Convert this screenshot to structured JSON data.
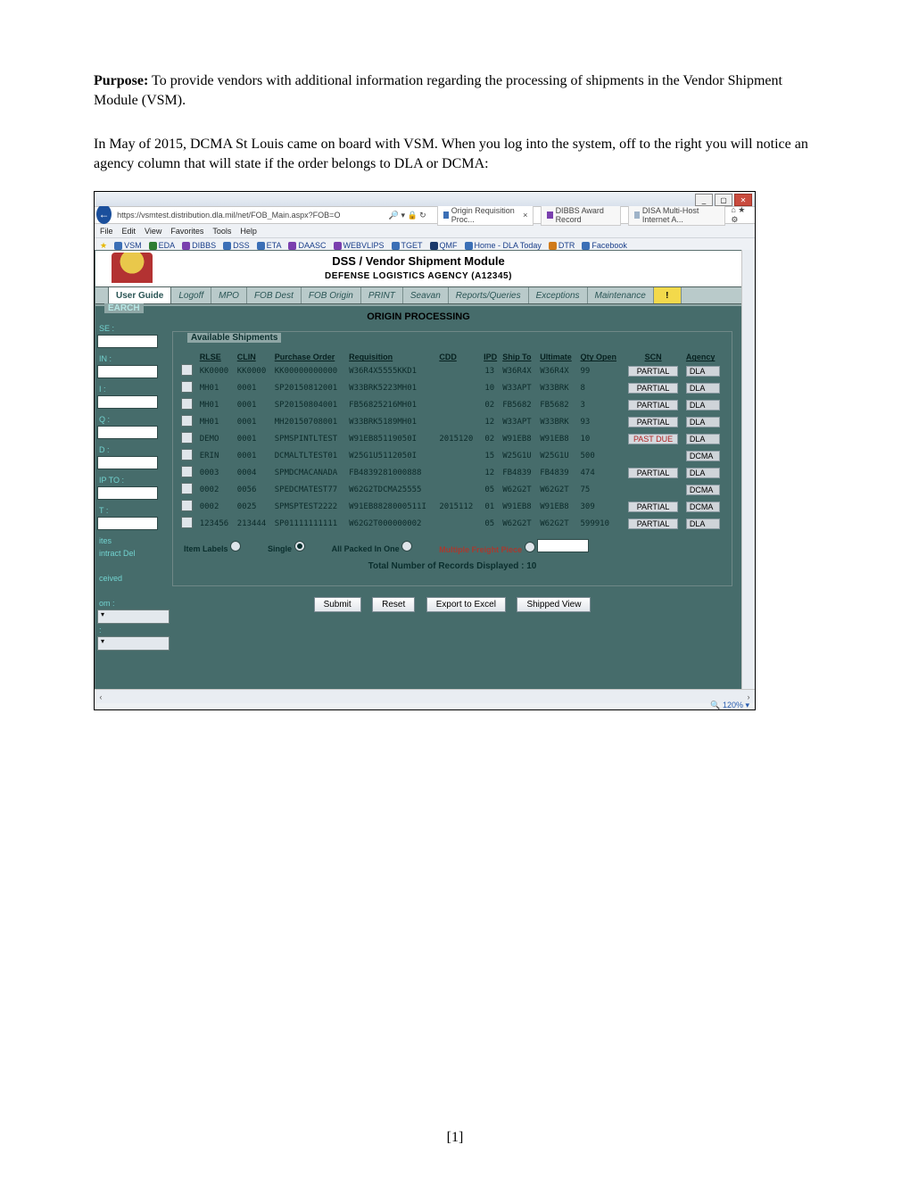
{
  "doc": {
    "purpose_label": "Purpose:",
    "purpose_text": "  To provide vendors with additional information regarding the processing of shipments in the Vendor Shipment Module (VSM).",
    "para2": "In May of 2015, DCMA St Louis came on board with VSM.  When you log into the system, off to the right you will notice an agency column that will state if the order belongs to DLA or DCMA:",
    "page_number": "[1]"
  },
  "browser": {
    "url": "https://vsmtest.distribution.dla.mil/net/FOB_Main.aspx?FOB=O",
    "search_hint": "🔎 ▾ 🔒 ↻",
    "tab1": "Origin Requisition Proc...",
    "tab2": "DIBBS Award Record",
    "tab3": "DISA Multi-Host Internet A...",
    "menu": [
      "File",
      "Edit",
      "View",
      "Favorites",
      "Tools",
      "Help"
    ],
    "favorites": [
      "VSM",
      "EDA",
      "DIBBS",
      "DSS",
      "ETA",
      "DAASC",
      "WEBVLIPS",
      "TGET",
      "QMF",
      "Home - DLA Today",
      "DTR",
      "Facebook"
    ],
    "zoom": "🔍 120%  ▾"
  },
  "app": {
    "banner_title": "DSS / Vendor Shipment Module",
    "banner_sub": "DEFENSE LOGISTICS AGENCY (A12345)",
    "tabs": [
      "User Guide",
      "Logoff",
      "MPO",
      "FOB Dest",
      "FOB Origin",
      "PRINT",
      "Seavan",
      "Reports/Queries",
      "Exceptions",
      "Maintenance"
    ],
    "section_title": "ORIGIN PROCESSING",
    "sidebar": {
      "legend": "EARCH",
      "lbls": [
        "SE :",
        "IN :",
        "I :",
        "Q :",
        "D :",
        "IP TO :",
        "T :",
        "ites",
        "intract Del",
        "ceived",
        "om :",
        ":"
      ]
    },
    "grid": {
      "legend": "Available Shipments",
      "headers": [
        "",
        "RLSE",
        "CLIN",
        "Purchase Order",
        "Requisition",
        "CDD",
        "IPD",
        "Ship To",
        "Ultimate",
        "Qty Open",
        "SCN",
        "Agency"
      ],
      "rows": [
        {
          "r": "KK0000",
          "c": "KK0000",
          "po": "KK00000000000",
          "rq": "W36R4X5555KKD1",
          "cdd": "",
          "ipd": "13",
          "st": "W36R4X",
          "ul": "W36R4X",
          "qo": "99",
          "scn": "PARTIAL",
          "ag": "DLA"
        },
        {
          "r": "MH01",
          "c": "0001",
          "po": "SP20150812001",
          "rq": "W33BRK5223MH01",
          "cdd": "",
          "ipd": "10",
          "st": "W33APT",
          "ul": "W33BRK",
          "qo": "8",
          "scn": "PARTIAL",
          "ag": "DLA"
        },
        {
          "r": "MH01",
          "c": "0001",
          "po": "SP20150804001",
          "rq": "FB56825216MH01",
          "cdd": "",
          "ipd": "02",
          "st": "FB5682",
          "ul": "FB5682",
          "qo": "3",
          "scn": "PARTIAL",
          "ag": "DLA"
        },
        {
          "r": "MH01",
          "c": "0001",
          "po": "MH20150708001",
          "rq": "W33BRK5189MH01",
          "cdd": "",
          "ipd": "12",
          "st": "W33APT",
          "ul": "W33BRK",
          "qo": "93",
          "scn": "PARTIAL",
          "ag": "DLA"
        },
        {
          "r": "DEMO",
          "c": "0001",
          "po": "SPMSPINTLTEST",
          "rq": "W91EB85119050I",
          "cdd": "2015120",
          "ipd": "02",
          "st": "W91EB8",
          "ul": "W91EB8",
          "qo": "10",
          "scn": "PAST DUE",
          "ag": "DLA"
        },
        {
          "r": "ERIN",
          "c": "0001",
          "po": "DCMALTLTEST01",
          "rq": "W25G1U5112050I",
          "cdd": "",
          "ipd": "15",
          "st": "W25G1U",
          "ul": "W25G1U",
          "qo": "500",
          "scn": "",
          "ag": "DCMA"
        },
        {
          "r": "0003",
          "c": "0004",
          "po": "SPMDCMACANADA",
          "rq": "FB4839281000888",
          "cdd": "",
          "ipd": "12",
          "st": "FB4839",
          "ul": "FB4839",
          "qo": "474",
          "scn": "PARTIAL",
          "ag": "DLA"
        },
        {
          "r": "0002",
          "c": "0056",
          "po": "SPEDCMATEST77",
          "rq": "W62G2TDCMA25555",
          "cdd": "",
          "ipd": "05",
          "st": "W62G2T",
          "ul": "W62G2T",
          "qo": "75",
          "scn": "",
          "ag": "DCMA"
        },
        {
          "r": "0002",
          "c": "0025",
          "po": "SPMSPTEST2222",
          "rq": "W91EB8828000511I",
          "cdd": "2015112",
          "ipd": "01",
          "st": "W91EB8",
          "ul": "W91EB8",
          "qo": "309",
          "scn": "PARTIAL",
          "ag": "DCMA"
        },
        {
          "r": "123456",
          "c": "213444",
          "po": "SP01111111111",
          "rq": "W62G2T000000002",
          "cdd": "",
          "ipd": "05",
          "st": "W62G2T",
          "ul": "W62G2T",
          "qo": "599910",
          "scn": "PARTIAL",
          "ag": "DLA"
        }
      ]
    },
    "radios": {
      "a": "Item Labels",
      "b": "Single",
      "c": "All Packed In One",
      "d": "Multiple Freight Piece"
    },
    "count_row": "Total Number of Records Displayed : 10",
    "buttons": [
      "Submit",
      "Reset",
      "Export to Excel",
      "Shipped View"
    ]
  }
}
